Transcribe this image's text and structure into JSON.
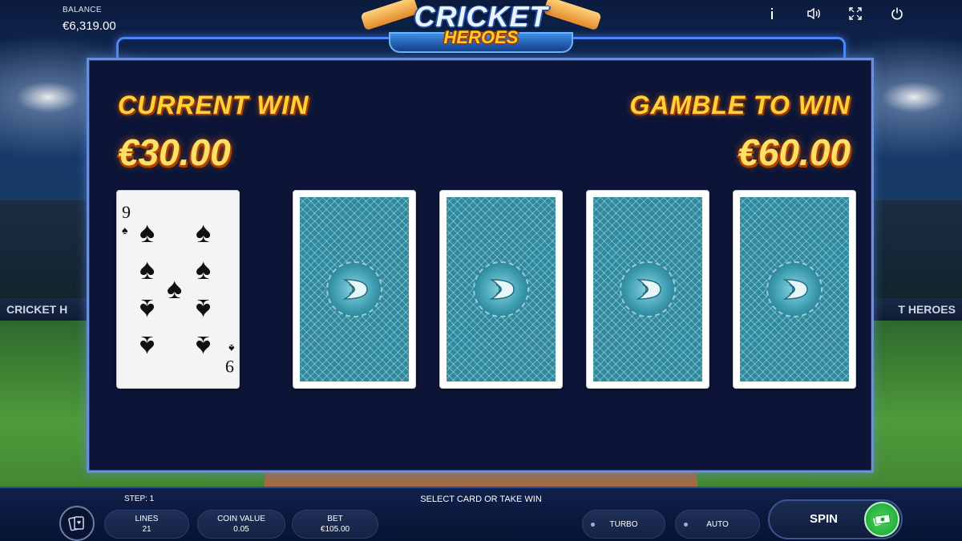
{
  "header": {
    "balance_label": "BALANCE",
    "balance_value": "€6,319.00",
    "logo_line1": "CRICKET",
    "logo_line2": "HEROES",
    "icons": [
      "info-icon",
      "sound-icon",
      "fullscreen-icon",
      "power-icon"
    ]
  },
  "background": {
    "board_left": "CRICKET H",
    "board_right": "T HEROES"
  },
  "gamble": {
    "current_win_label": "CURRENT WIN",
    "current_win_value": "€30.00",
    "gamble_label": "GAMBLE TO WIN",
    "gamble_value": "€60.00",
    "dealer_card": {
      "rank": "9",
      "suit": "♠"
    },
    "face_down_cards": 4
  },
  "bottom_bar": {
    "step_label": "STEP: 1",
    "status_text": "SELECT CARD OR TAKE WIN",
    "lines_label": "LINES",
    "lines_value": "21",
    "coin_value_label": "COIN VALUE",
    "coin_value": "0.05",
    "bet_label": "BET",
    "bet_value": "€105.00",
    "turbo_label": "TURBO",
    "auto_label": "AUTO",
    "spin_label": "SPIN"
  },
  "colors": {
    "accent_gold": "#ffd23a",
    "panel_bg": "#0c1537",
    "card_back": "#2e8a9e",
    "spin_green": "#44d85b"
  }
}
